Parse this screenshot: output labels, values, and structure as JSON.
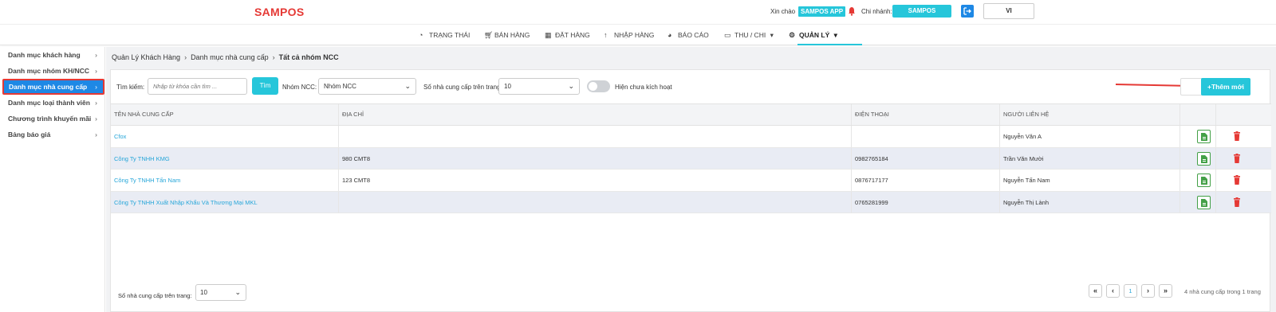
{
  "header": {
    "logo": "SAMPOS",
    "greeting": "Xin chào",
    "app_badge": "SAMPOS APP",
    "branch_label": "Chi nhánh:",
    "branch_value": "SAMPOS",
    "language": "VI"
  },
  "nav": {
    "items": [
      {
        "label": "TRẠNG THÁI",
        "icon": "dashboard-icon"
      },
      {
        "label": "BÁN HÀNG",
        "icon": "cart-icon"
      },
      {
        "label": "ĐẶT HÀNG",
        "icon": "calendar-icon"
      },
      {
        "label": "NHẬP HÀNG",
        "icon": "arrow-up-icon"
      },
      {
        "label": "BÁO CÁO",
        "icon": "pie-chart-icon"
      },
      {
        "label": "THU / CHI",
        "icon": "money-icon"
      },
      {
        "label": "QUẢN LÝ",
        "icon": "gear-icon"
      }
    ],
    "active": "QUẢN LÝ"
  },
  "sidebar": {
    "items": [
      {
        "label": "Danh mục khách hàng"
      },
      {
        "label": "Danh mục nhóm KH/NCC"
      },
      {
        "label": "Danh mục nhà cung cấp"
      },
      {
        "label": "Danh mục loại thành viên"
      },
      {
        "label": "Chương trình khuyến mãi"
      },
      {
        "label": "Bảng báo giá"
      }
    ],
    "active": "Danh mục nhà cung cấp"
  },
  "breadcrumb": {
    "items": [
      "Quản Lý Khách Hàng",
      "Danh mục nhà cung cấp",
      "Tất cả nhóm NCC"
    ]
  },
  "filter": {
    "search_label": "Tìm kiếm:",
    "search_placeholder": "Nhập từ khóa cần tìm ...",
    "search_button": "Tìm",
    "group_label": "Nhóm NCC:",
    "group_value": "Nhóm NCC",
    "per_page_label": "Số nhà cung cấp trên trang:",
    "per_page_value": "10",
    "toggle_label": "Hiện chưa kích hoạt",
    "toggle_on": false,
    "add_button": "+Thêm mới"
  },
  "table": {
    "columns": [
      "TÊN NHÀ CUNG CẤP",
      "ĐỊA CHỈ",
      "ĐIỆN THOẠI",
      "NGƯỜI LIÊN HỆ"
    ],
    "rows": [
      {
        "name": "Cfox",
        "address": "",
        "phone": "",
        "contact": "Nguyễn Văn A"
      },
      {
        "name": "Công Ty TNHH KMG",
        "address": "980 CMT8",
        "phone": "0982765184",
        "contact": "Trần Văn Mười"
      },
      {
        "name": "Công Ty TNHH Tấn Nam",
        "address": "123 CMT8",
        "phone": "0876717177",
        "contact": "Nguyễn Tấn Nam"
      },
      {
        "name": "Công Ty TNHH Xuất Nhập Khẩu Và Thương Mại MKL",
        "address": "",
        "phone": "0765281999",
        "contact": "Nguyễn Thị Lành"
      }
    ]
  },
  "footer": {
    "per_page_label": "Số nhà cung cấp trên trang:",
    "per_page_value": "10",
    "current_page": "1",
    "info": "4 nhà cung cấp trong 1 trang"
  },
  "colors": {
    "accent": "#26c6da",
    "primary": "#1e88e5",
    "danger": "#e53935",
    "link": "#26a6d9"
  }
}
